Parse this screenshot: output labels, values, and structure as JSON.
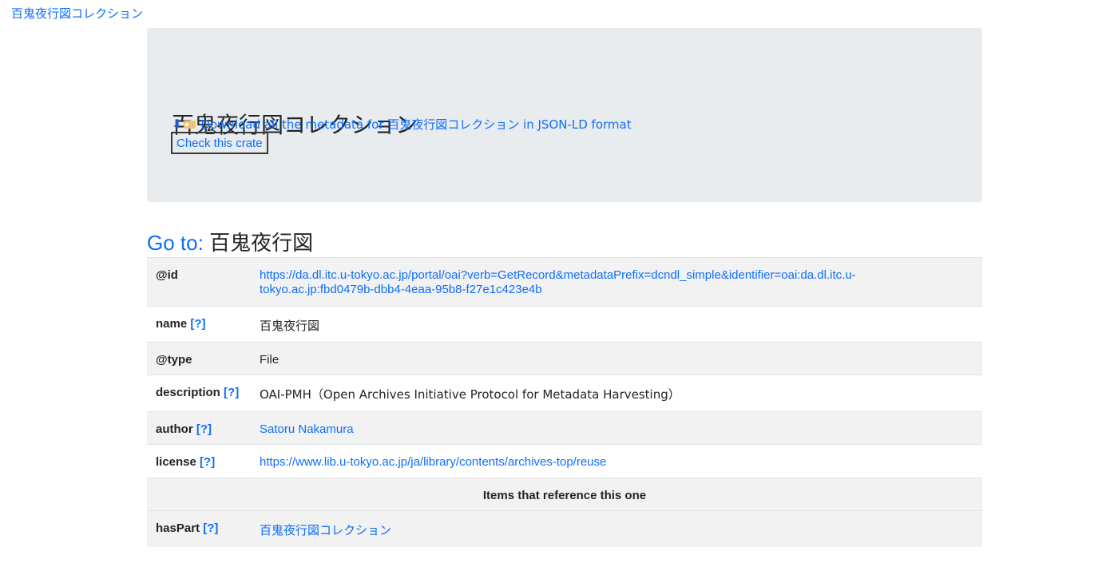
{
  "breadcrumb": "百鬼夜行図コレクション",
  "header": {
    "title": "百鬼夜行図コレクション",
    "download_text": "Download all the metadata for 百鬼夜行図コレクション in JSON-LD format",
    "check_button": "Check this crate"
  },
  "goto": {
    "label": "Go to:",
    "name": "百鬼夜行図"
  },
  "help_marker": "[?]",
  "properties": {
    "id": {
      "key": "@id",
      "value_line1": "https://da.dl.itc.u-tokyo.ac.jp/portal/oai?verb=GetRecord&metadataPrefix=dcndl_simple&identifier=oai:da.dl.itc.u-",
      "value_line2": "tokyo.ac.jp:fbd0479b-dbb4-4eaa-95b8-f27e1c423e4b"
    },
    "name": {
      "key": "name",
      "value": "百鬼夜行図"
    },
    "type": {
      "key": "@type",
      "value": "File"
    },
    "description": {
      "key": "description",
      "value": "OAI-PMH（Open Archives Initiative Protocol for Metadata Harvesting）"
    },
    "author": {
      "key": "author",
      "value": "Satoru Nakamura"
    },
    "license": {
      "key": "license",
      "value": "https://www.lib.u-tokyo.ac.jp/ja/library/contents/archives-top/reuse"
    },
    "section_heading": "Items that reference this one",
    "hasPart": {
      "key": "hasPart",
      "value": "百鬼夜行図コレクション"
    }
  },
  "icons": {
    "download": "down-arrow-icon",
    "label": "label-tag-icon"
  },
  "colors": {
    "link": "#0d6efd",
    "jumbotron": "#e9ecef",
    "row_alt": "#f2f2f2"
  }
}
